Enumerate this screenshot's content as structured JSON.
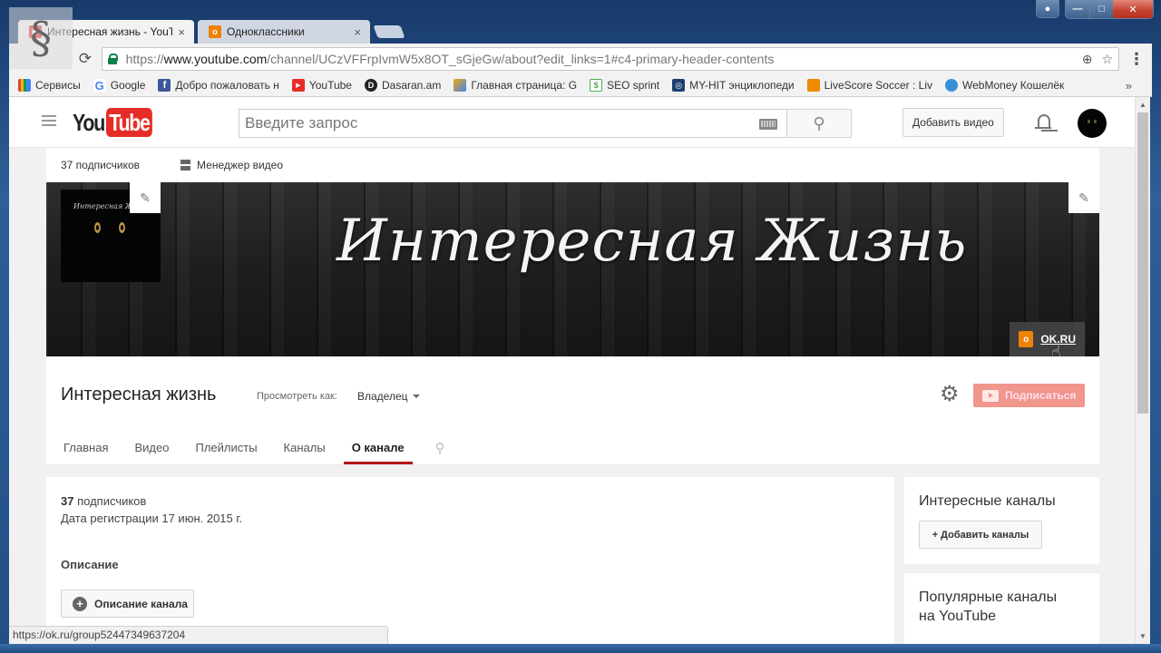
{
  "window": {
    "controls": {
      "user_icon": "user-icon",
      "minimize_icon": "minimize-icon",
      "maximize_icon": "maximize-icon",
      "close_icon": "close-icon"
    },
    "overlay_logo": "dragon-logo"
  },
  "browser": {
    "tabs": [
      {
        "title": "Интересная жизнь - YouTube",
        "favicon": "youtube-icon",
        "favicon_color": "#e52d27",
        "active": true
      },
      {
        "title": "Одноклассники",
        "favicon": "ok-icon",
        "favicon_color": "#ee8208",
        "active": false
      }
    ],
    "tab_close_glyph": "×",
    "address_bar": {
      "scheme": "https://",
      "host": "www.youtube.com",
      "path": "/channel/UCzVFFrpIvmW5x8OT_sGjeGw/about?edit_links=1#c4-primary-header-contents",
      "secure": true
    },
    "reload_glyph": "⟳",
    "zoom_glyph": "⊕",
    "star_glyph": "☆",
    "menu_glyph": "⋮",
    "bookmarks": [
      {
        "label": "Сервисы",
        "icon": "apps-icon",
        "color": "#4285f4"
      },
      {
        "label": "Google",
        "icon": "google-icon",
        "color": "#4285f4"
      },
      {
        "label": "Добро пожаловать н",
        "icon": "facebook-icon",
        "color": "#3b5998"
      },
      {
        "label": "YouTube",
        "icon": "youtube-icon",
        "color": "#e52d27"
      },
      {
        "label": "Dasaran.am",
        "icon": "dasaran-icon",
        "color": "#222222"
      },
      {
        "label": "Главная страница: G",
        "icon": "page-icon",
        "color": "#f2a60d"
      },
      {
        "label": "SEO sprint",
        "icon": "seosprint-icon",
        "color": "#4caf50"
      },
      {
        "label": "MY-HIT энциклопеди",
        "icon": "myhit-icon",
        "color": "#1c3f6e"
      },
      {
        "label": "LiveScore Soccer : Liv",
        "icon": "livescore-icon",
        "color": "#f08a00"
      },
      {
        "label": "WebMoney Кошелёк",
        "icon": "webmoney-icon",
        "color": "#3a8fd6"
      }
    ],
    "bookmarks_overflow": "»",
    "status_url": "https://ok.ru/group52447349637204"
  },
  "youtube": {
    "logo": {
      "you": "You",
      "tube": "Tube"
    },
    "search": {
      "placeholder": "Введите запрос",
      "value": ""
    },
    "upload_label": "Добавить видео",
    "notifications_icon": "bell-icon",
    "avatar_icon": "avatar"
  },
  "channel": {
    "subscribers_short": "37 подписчиков",
    "video_manager_label": "Менеджер видео",
    "banner_title": "Интересная Жизнь",
    "channel_art_label": "Интересная Жи",
    "ok_link": "OK.RU",
    "name": "Интересная жизнь",
    "view_as_label": "Просмотреть как:",
    "view_as_value": "Владелец",
    "subscribe_label": "Подписаться",
    "accent_color": "#b31217",
    "tabs": [
      {
        "label": "Главная",
        "active": false
      },
      {
        "label": "Видео",
        "active": false
      },
      {
        "label": "Плейлисты",
        "active": false
      },
      {
        "label": "Каналы",
        "active": false
      },
      {
        "label": "О канале",
        "active": true
      }
    ]
  },
  "about": {
    "subscribers_count": "37",
    "subscribers_word": "подписчиков",
    "registration": "Дата регистрации 17 июн. 2015 г.",
    "description_heading": "Описание",
    "description_button": "Описание канала"
  },
  "sidebar": {
    "featured_title": "Интересные каналы",
    "add_channels_label": "+ Добавить каналы",
    "popular_title_line1": "Популярные каналы",
    "popular_title_line2": "на YouTube"
  }
}
